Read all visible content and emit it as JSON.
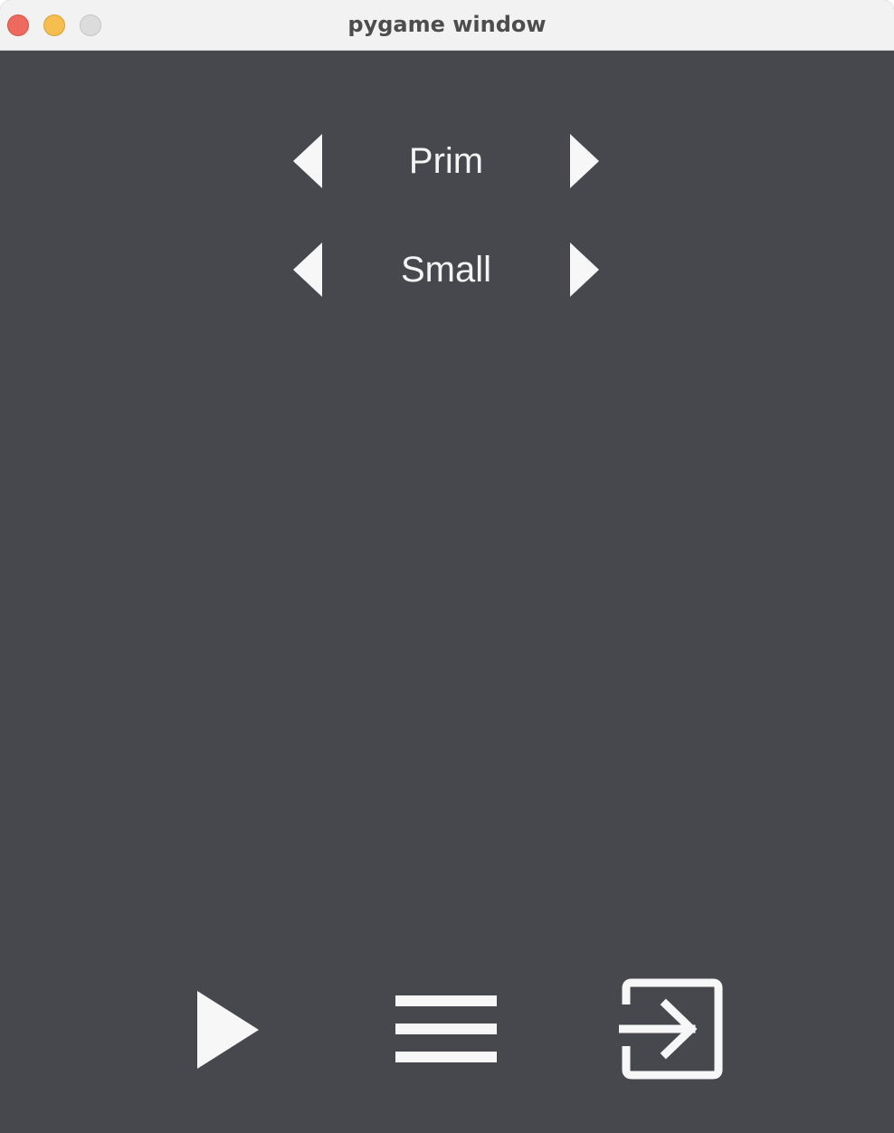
{
  "window": {
    "title": "pygame window",
    "background_color": "#46484d"
  },
  "selectors": [
    {
      "value": "Prim",
      "prev_icon": "triangle-left-icon",
      "next_icon": "triangle-right-icon"
    },
    {
      "value": "Small",
      "prev_icon": "triangle-left-icon",
      "next_icon": "triangle-right-icon"
    }
  ],
  "toolbar": {
    "play_icon": "play-icon",
    "menu_icon": "hamburger-menu-icon",
    "exit_icon": "exit-icon"
  },
  "colors": {
    "icon": "#f7f7f7",
    "text": "#f4f4f4",
    "traffic_close": "#ee6a5f",
    "traffic_minimize": "#f5be4f",
    "traffic_maximize": "#dcdcdc"
  }
}
